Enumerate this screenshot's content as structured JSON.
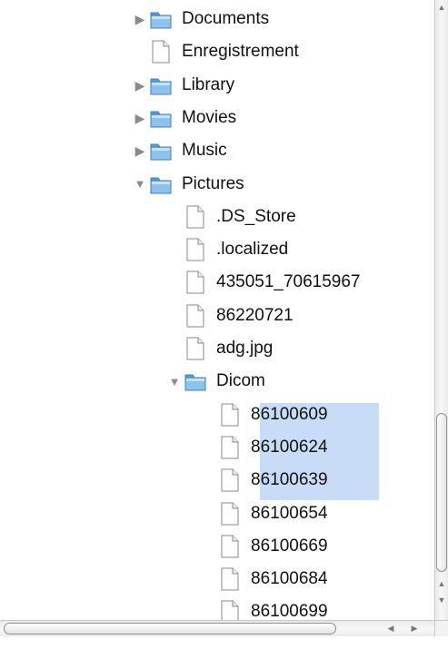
{
  "tree": {
    "items": [
      {
        "label": "Documents",
        "type": "folder",
        "state": "collapsed",
        "depth": 0
      },
      {
        "label": "Enregistrement",
        "type": "file",
        "depth": 0
      },
      {
        "label": "Library",
        "type": "folder",
        "state": "collapsed",
        "depth": 0
      },
      {
        "label": "Movies",
        "type": "folder",
        "state": "collapsed",
        "depth": 0
      },
      {
        "label": "Music",
        "type": "folder",
        "state": "collapsed",
        "depth": 0
      },
      {
        "label": "Pictures",
        "type": "folder",
        "state": "expanded",
        "depth": 0
      },
      {
        "label": ".DS_Store",
        "type": "file",
        "depth": 1
      },
      {
        "label": ".localized",
        "type": "file",
        "depth": 1
      },
      {
        "label": "435051_70615967",
        "type": "file",
        "depth": 1
      },
      {
        "label": "86220721",
        "type": "file",
        "depth": 1
      },
      {
        "label": "adg.jpg",
        "type": "file",
        "depth": 1
      },
      {
        "label": "Dicom",
        "type": "folder",
        "state": "expanded",
        "depth": 1
      },
      {
        "label": "86100609",
        "type": "file",
        "depth": 2,
        "selected": true
      },
      {
        "label": "86100624",
        "type": "file",
        "depth": 2,
        "selected": true
      },
      {
        "label": "86100639",
        "type": "file",
        "depth": 2,
        "selected": true
      },
      {
        "label": "86100654",
        "type": "file",
        "depth": 2
      },
      {
        "label": "86100669",
        "type": "file",
        "depth": 2
      },
      {
        "label": "86100684",
        "type": "file",
        "depth": 2
      },
      {
        "label": "86100699",
        "type": "file",
        "depth": 2
      }
    ]
  },
  "icons": {
    "folder": "folder-icon",
    "file": "document-icon",
    "collapsed": "disclosure-triangle-right-icon",
    "expanded": "disclosure-triangle-down-icon"
  },
  "colors": {
    "selection": "#c9dcf7",
    "folder_body": "#8ec2ee",
    "text": "#111111"
  }
}
